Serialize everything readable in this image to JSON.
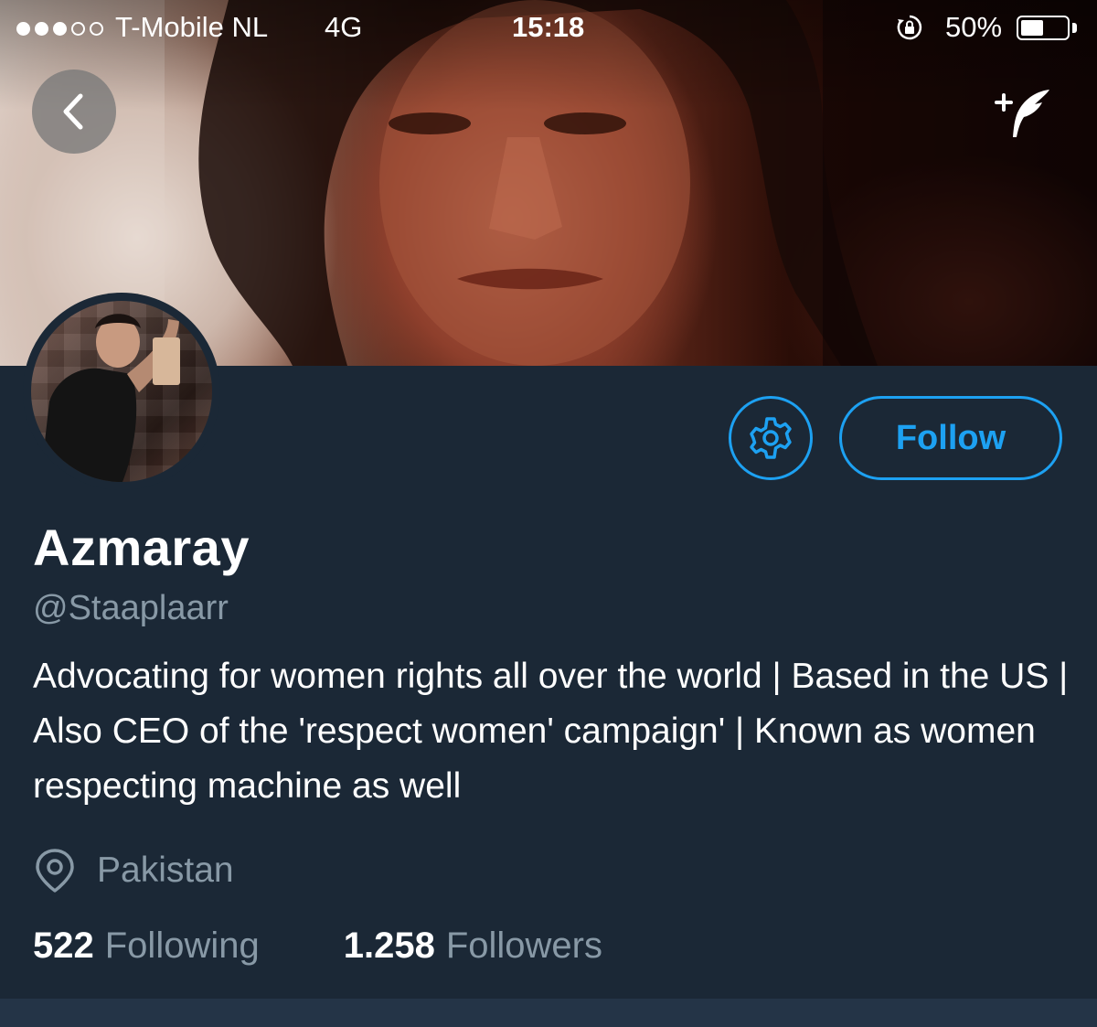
{
  "status_bar": {
    "carrier": "T-Mobile NL",
    "network": "4G",
    "time": "15:18",
    "battery_percent": "50%",
    "battery_level": 0.5,
    "signal_bars_filled": 3,
    "signal_bars_total": 5
  },
  "header": {
    "back_icon": "chevron-left-icon",
    "compose_icon": "compose-tweet-icon"
  },
  "profile": {
    "display_name": "Azmaray",
    "handle": "@Staaplaarr",
    "bio": "Advocating for women rights all over the world | Based in the US | Also CEO of the 'respect women' campaign' | Known as women respecting machine as well",
    "location": "Pakistan",
    "location_icon": "location-pin-icon"
  },
  "actions": {
    "settings_icon": "gear-icon",
    "follow_label": "Follow"
  },
  "stats": {
    "following_count": "522",
    "following_label": "Following",
    "followers_count": "1.258",
    "followers_label": "Followers"
  },
  "colors": {
    "background": "#1b2836",
    "accent": "#1da1f2",
    "secondary_text": "#8899a6",
    "primary_text": "#ffffff"
  }
}
